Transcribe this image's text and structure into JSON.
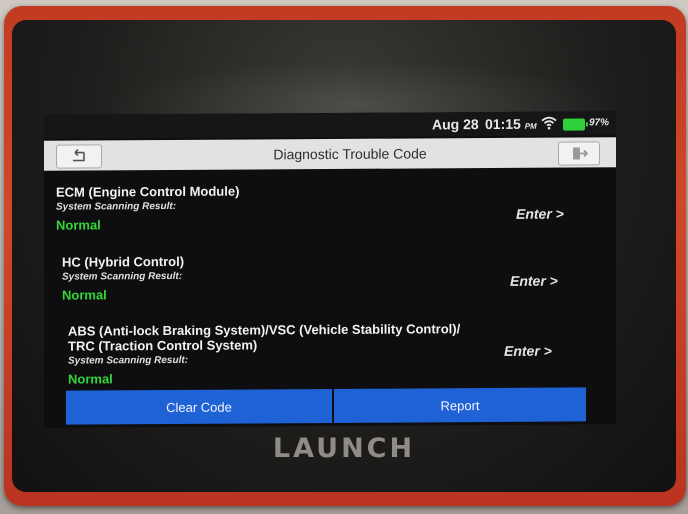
{
  "device": {
    "brand": "LAUNCH"
  },
  "status_bar": {
    "date": "Aug 28",
    "time": "01:15",
    "time_suffix": "PM",
    "battery": "97%",
    "icons": [
      "wifi-icon",
      "battery-icon"
    ]
  },
  "title_bar": {
    "title": "Diagnostic Trouble Code",
    "back_icon": "back-arrow-icon",
    "exit_icon": "exit-icon"
  },
  "systems": [
    {
      "name": "ECM (Engine Control Module)",
      "result_label": "System Scanning Result:",
      "result": "Normal",
      "action": "Enter >"
    },
    {
      "name": "HC (Hybrid Control)",
      "result_label": "System Scanning Result:",
      "result": "Normal",
      "action": "Enter >"
    },
    {
      "name": "ABS (Anti-lock Braking System)/VSC (Vehicle Stability Control)/",
      "name_line2": "TRC (Traction Control System)",
      "result_label": "System Scanning Result:",
      "result": "Normal",
      "action": "Enter >"
    }
  ],
  "footer": {
    "clear_code": "Clear Code",
    "report": "Report"
  },
  "colors": {
    "accent_button": "#1f62d6",
    "status_normal": "#34d63a",
    "device_body": "#c23a22"
  }
}
